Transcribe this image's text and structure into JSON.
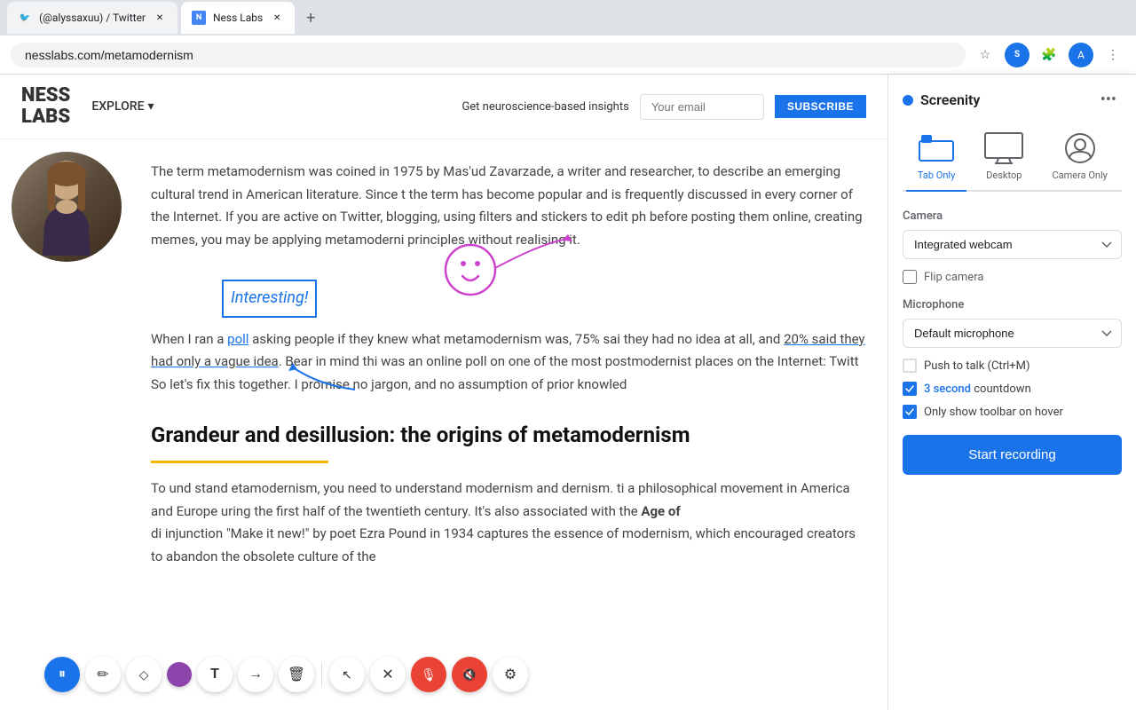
{
  "browser": {
    "tabs": [
      {
        "id": "twitter-tab",
        "title": "(@alyssaxuu) / Twitter",
        "favicon": "🐦",
        "active": false
      },
      {
        "id": "ness-labs-tab",
        "title": "Ness Labs",
        "favicon": "N",
        "active": true
      }
    ],
    "new_tab_label": "+",
    "url": "nesslabs.com/metamodernism",
    "star_icon": "☆",
    "extensions_icon": "🧩",
    "profile_icon": "A",
    "menu_icon": "⋮"
  },
  "ness_labs": {
    "logo_line1": "NESS",
    "logo_line2": "LABS",
    "nav_explore": "EXPLORE",
    "subscribe_label": "Get neuroscience-based insights",
    "email_placeholder": "Your email",
    "subscribe_btn": "SUBSCRIBE"
  },
  "article": {
    "body_text_1": "The term metamodernism was coined in 1975 by Mas'ud Zavarzade, a writer and researcher, to describe an emerging cultural trend in American literature. Since t the term has become popular and is frequently discussed in every corner of the Internet. If you are active on Twitter, blogging, using filters and stickers to edit ph before posting them online, creating memes, you may be applying metamoderni principles without realising it.",
    "link_poll": "poll",
    "body_text_2": "When I ran a poll asking people if they knew what metamodernism was, 75% sai they had no idea at all, and",
    "underlined_text": "20% said they had only a vague idea",
    "body_text_3": ". Bear in mind thi was an online poll on one of the most postmodernist places on the Internet: Twit So let's fix this together. I promise no jargon, and no assumption of prior knowled",
    "annotation": "Interesting!",
    "heading": "Grandeur and desillusion: the origins of metamodernism",
    "body_text_4": "To und stand etamodernism, you need to understand modernism and dernism. ti a philosophical movement in America and Europe uring the first half of the twentieth century. It's also associated with the",
    "bold_text": "Age of",
    "body_text_5": "di injunction \"Make it new!\" by poet Ezra Pound in 1934 captures the essence of modernism, which encouraged creators to abandon the obsolete culture of the"
  },
  "screenity": {
    "title": "Screenity",
    "menu_icon": "•••",
    "modes": [
      {
        "id": "tab-only",
        "label": "Tab Only",
        "active": true
      },
      {
        "id": "desktop",
        "label": "Desktop",
        "active": false
      },
      {
        "id": "camera-only",
        "label": "Camera Only",
        "active": false
      }
    ],
    "camera_label": "Camera",
    "camera_options": [
      "Integrated webcam"
    ],
    "camera_selected": "Integrated webcam",
    "flip_camera_label": "Flip camera",
    "flip_camera_checked": false,
    "microphone_label": "Microphone",
    "microphone_options": [
      "Default microphone"
    ],
    "microphone_selected": "Default microphone",
    "push_to_talk_label": "Push to talk (Ctrl+M)",
    "push_to_talk_checked": false,
    "countdown_text": "3 second",
    "countdown_label": "countdown",
    "only_show_toolbar_label": "Only show toolbar on hover",
    "only_show_toolbar_checked": true,
    "start_recording_btn": "Start recording"
  },
  "toolbar": {
    "pause_icon": "⏸",
    "arrow_icon": "↖",
    "close_icon": "✕",
    "pen_icon": "✏",
    "eraser_icon": "◇",
    "text_icon": "T",
    "forward_icon": "→",
    "trash_icon": "🗑",
    "mute_icon": "🎙",
    "speaker_icon": "🔊",
    "settings_icon": "⚙"
  }
}
